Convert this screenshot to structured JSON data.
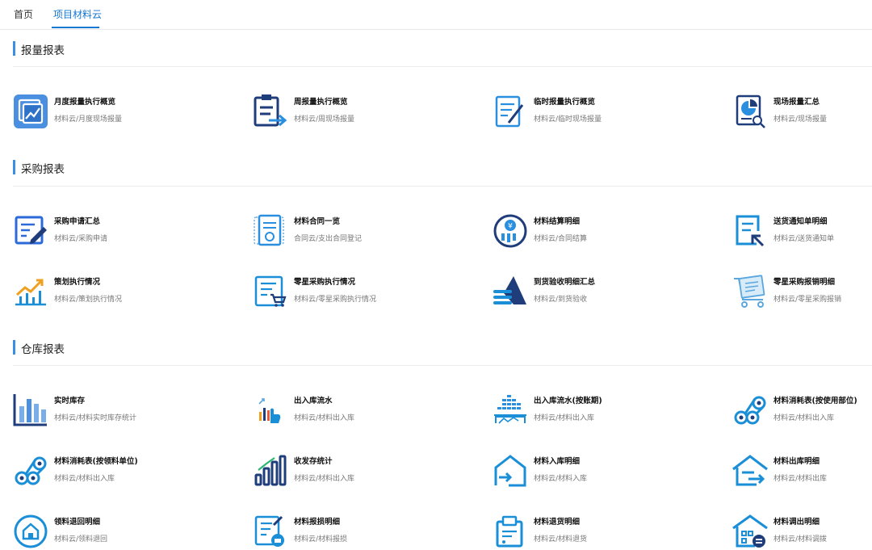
{
  "tabs": [
    {
      "label": "首页",
      "active": false
    },
    {
      "label": "项目材料云",
      "active": true
    }
  ],
  "accent_color": "#1677d2",
  "sections": [
    {
      "title": "报量报表",
      "items": [
        {
          "name": "月度报量执行概览",
          "path": "材料云/月度现场报量",
          "icon": "monthly-chart-icon"
        },
        {
          "name": "周报量执行概览",
          "path": "材料云/周现场报量",
          "icon": "weekly-report-arrow-icon"
        },
        {
          "name": "临时报量执行概览",
          "path": "材料云/临时现场报量",
          "icon": "document-edit-icon"
        },
        {
          "name": "现场报量汇总",
          "path": "材料云/现场报量",
          "icon": "pie-report-search-icon"
        }
      ]
    },
    {
      "title": "采购报表",
      "items": [
        {
          "name": "采购申请汇总",
          "path": "材料云/采购申请",
          "icon": "form-pen-icon"
        },
        {
          "name": "材料合同一览",
          "path": "合同云/支出合同登记",
          "icon": "contract-icon"
        },
        {
          "name": "材料结算明细",
          "path": "材料云/合同结算",
          "icon": "settlement-yen-icon"
        },
        {
          "name": "送货通知单明细",
          "path": "材料云/送货通知单",
          "icon": "delivery-notice-icon"
        },
        {
          "name": "策划执行情况",
          "path": "材料云/策划执行情况",
          "icon": "trend-chart-icon"
        },
        {
          "name": "零星采购执行情况",
          "path": "材料云/零星采购执行情况",
          "icon": "cart-list-icon"
        },
        {
          "name": "到货验收明细汇总",
          "path": "材料云/到货验收",
          "icon": "arrival-acceptance-icon"
        },
        {
          "name": "零星采购报销明细",
          "path": "材料云/零星采购报销",
          "icon": "cart-reimburse-icon"
        }
      ]
    },
    {
      "title": "仓库报表",
      "items": [
        {
          "name": "实时库存",
          "path": "材料云/材料实时库存统计",
          "icon": "bar-chart-icon"
        },
        {
          "name": "出入库流水",
          "path": "材料云/材料出入库",
          "icon": "hand-chart-icon"
        },
        {
          "name": "出入库流水(按账期)",
          "path": "材料云/材料出入库",
          "icon": "period-flow-icon"
        },
        {
          "name": "材料消耗表(按使用部位)",
          "path": "材料云/材料出入库",
          "icon": "pipes-icon"
        },
        {
          "name": "材料消耗表(按领料单位)",
          "path": "材料云/材料出入库",
          "icon": "pipes-icon"
        },
        {
          "name": "收发存统计",
          "path": "材料云/材料出入库",
          "icon": "rising-bars-icon"
        },
        {
          "name": "材料入库明细",
          "path": "材料云/材料入库",
          "icon": "warehouse-in-icon"
        },
        {
          "name": "材料出库明细",
          "path": "材料云/材料出库",
          "icon": "warehouse-out-icon"
        },
        {
          "name": "领料退回明细",
          "path": "材料云/领料退回",
          "icon": "return-home-icon"
        },
        {
          "name": "材料报损明细",
          "path": "材料云/材料报损",
          "icon": "damage-report-icon"
        },
        {
          "name": "材料退货明细",
          "path": "材料云/材料退货",
          "icon": "return-goods-icon"
        },
        {
          "name": "材料调出明细",
          "path": "材料云/材料调拨",
          "icon": "transfer-building-icon"
        }
      ]
    }
  ]
}
